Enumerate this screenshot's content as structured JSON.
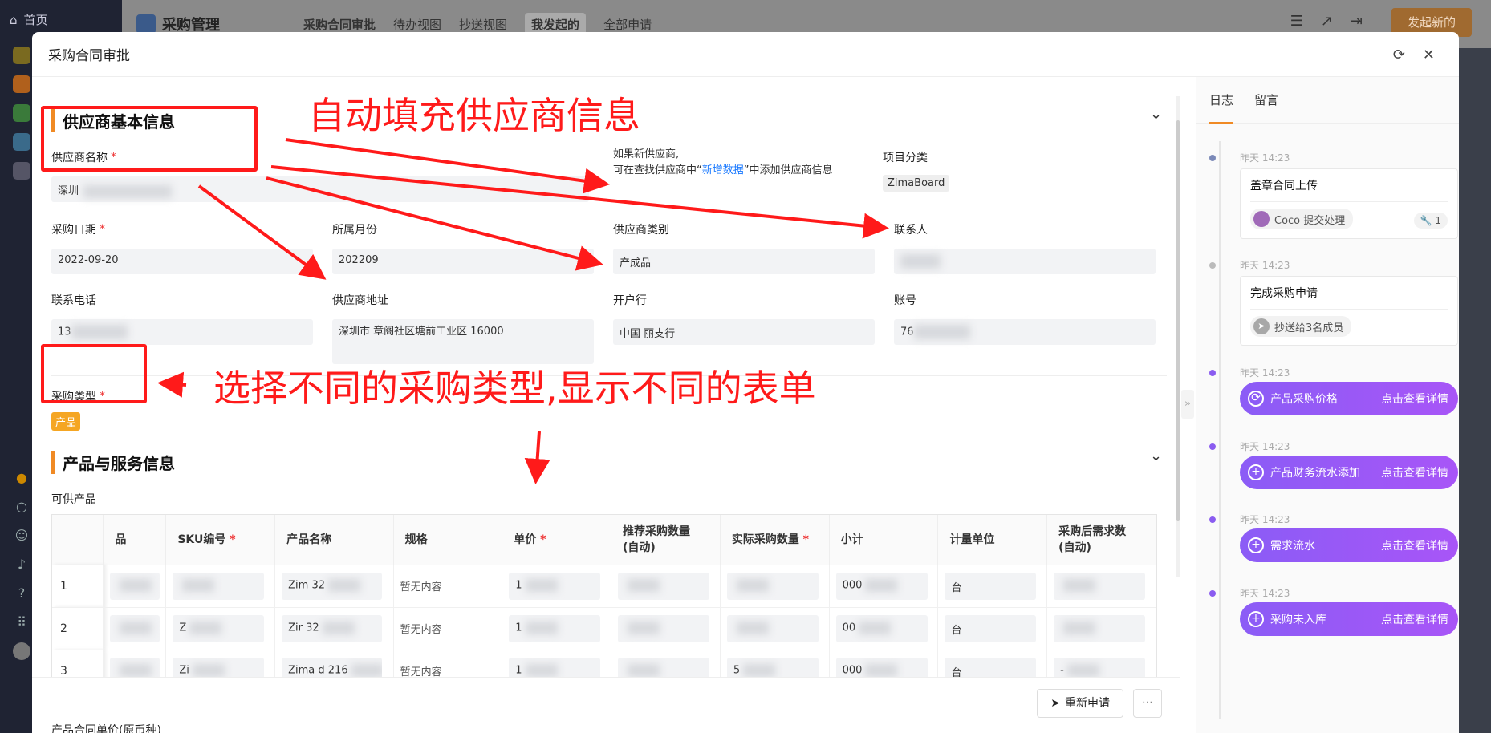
{
  "background": {
    "sidebar": {
      "home_label": "首页",
      "item_colors": [
        "#7a6a20",
        "#b0601c",
        "#3a7a3a",
        "#3a6a8a",
        "#556"
      ]
    },
    "topbar": {
      "app_title": "采购管理",
      "view_title": "采购合同审批",
      "tabs": [
        "待办视图",
        "抄送视图",
        "我发起的",
        "全部申请"
      ],
      "launch_button": "发起新的"
    }
  },
  "modal": {
    "title": "采购合同审批",
    "sections": {
      "supplier_info": "供应商基本信息",
      "product_info": "产品与服务信息"
    },
    "fields": {
      "supplier_name": {
        "label": "供应商名称",
        "value": "深圳"
      },
      "new_supplier_hint": {
        "line1": "如果新供应商,",
        "line2_prefix": "可在查找供应商中“",
        "link": "新增数据",
        "line2_suffix": "”中添加供应商信息"
      },
      "project_category": {
        "label": "项目分类",
        "value": "ZimaBoard"
      },
      "purchase_date": {
        "label": "采购日期",
        "value": "2022-09-20"
      },
      "month": {
        "label": "所属月份",
        "value": "202209"
      },
      "supplier_type": {
        "label": "供应商类别",
        "value": "产成品"
      },
      "contact": {
        "label": "联系人",
        "value": ""
      },
      "phone": {
        "label": "联系电话",
        "value": "13"
      },
      "address": {
        "label": "供应商地址",
        "value": "深圳市 章阁社区塘前工业区 16000"
      },
      "bank": {
        "label": "开户行",
        "value": "中国 丽支行"
      },
      "account": {
        "label": "账号",
        "value": "76"
      },
      "purchase_type": {
        "label": "采购类型",
        "value": "产品"
      }
    },
    "table_label": "可供产品",
    "table": {
      "headers": [
        "",
        "品",
        "SKU编号",
        "产品名称",
        "规格",
        "单价",
        "推荐采购数量\n(自动)",
        "实际采购数量",
        "小计",
        "计量单位",
        "采购后需求数\n(自动)"
      ],
      "required_cols": [
        2,
        5,
        7
      ],
      "rows": [
        [
          "1",
          "",
          "",
          "Zim 32",
          "暂无内容",
          "1",
          "",
          "",
          "000",
          "台",
          ""
        ],
        [
          "2",
          "",
          "Z",
          "Zir 32",
          "暂无内容",
          "1",
          "",
          "",
          "00",
          "台",
          ""
        ],
        [
          "3",
          "",
          "Zi",
          "Zima d 216",
          "暂无内容",
          "1",
          "",
          "5",
          "000",
          "台",
          "-"
        ]
      ]
    },
    "cutoff_label": "产品合同单价(原币种)",
    "footer": {
      "reapply_button": "重新申请",
      "more_button": "⋯"
    }
  },
  "activity": {
    "tabs": [
      "日志",
      "留言"
    ],
    "items": [
      {
        "time": "昨天 14:23",
        "title": "盖章合同上传",
        "chip": "Coco 提交处理",
        "count": "1"
      },
      {
        "time": "昨天 14:23",
        "title": "完成采购申请",
        "chip": "抄送给3名成员"
      },
      {
        "time": "昨天 14:23",
        "pill": "产品采购价格",
        "link": "点击查看详情"
      },
      {
        "time": "昨天 14:23",
        "pill": "产品财务流水添加",
        "link": "点击查看详情"
      },
      {
        "time": "昨天 14:23",
        "pill": "需求流水",
        "link": "点击查看详情"
      },
      {
        "time": "昨天 14:23",
        "pill": "采购未入库",
        "link": "点击查看详情"
      }
    ]
  },
  "annotations": {
    "auto_fill": "自动填充供应商信息",
    "purchase_type_note": "选择不同的采购类型,显示不同的表单"
  },
  "colors": {
    "accent": "#f08a24",
    "annotation": "#ff1a1a",
    "pill": "#8b5cf6",
    "link": "#1677ff"
  }
}
